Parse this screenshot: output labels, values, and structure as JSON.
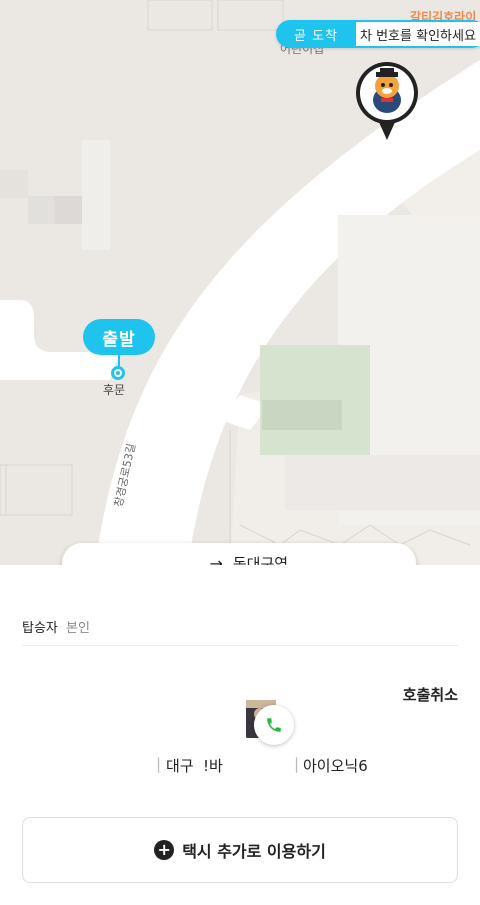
{
  "map": {
    "eta_badge": "곧 도착",
    "eta_message": "차 번호를 확인하세요",
    "start_pin_label": "출발",
    "start_place": "후문",
    "road_label": "창경궁로53길",
    "building_label": "어린이집",
    "building_label_2": "갈티김호라이"
  },
  "route": {
    "from": "..",
    "arrow": "→",
    "to": "동대구역"
  },
  "sheet": {
    "passenger_label": "탑승자",
    "passenger_value": "본인",
    "cancel_label": "호출취소",
    "car_region": "대구",
    "car_plate_fragment": "!바",
    "car_model": "아이오닉6",
    "add_taxi_label": "택시 추가로 이용하기"
  },
  "colors": {
    "accent": "#1ec4ee",
    "map_bg": "#ebe8e4",
    "road": "#ffffff",
    "call_icon": "#27b83c"
  },
  "icons": [
    "driver-avatar-icon",
    "phone-icon",
    "plus-icon",
    "arrow-right-icon"
  ]
}
